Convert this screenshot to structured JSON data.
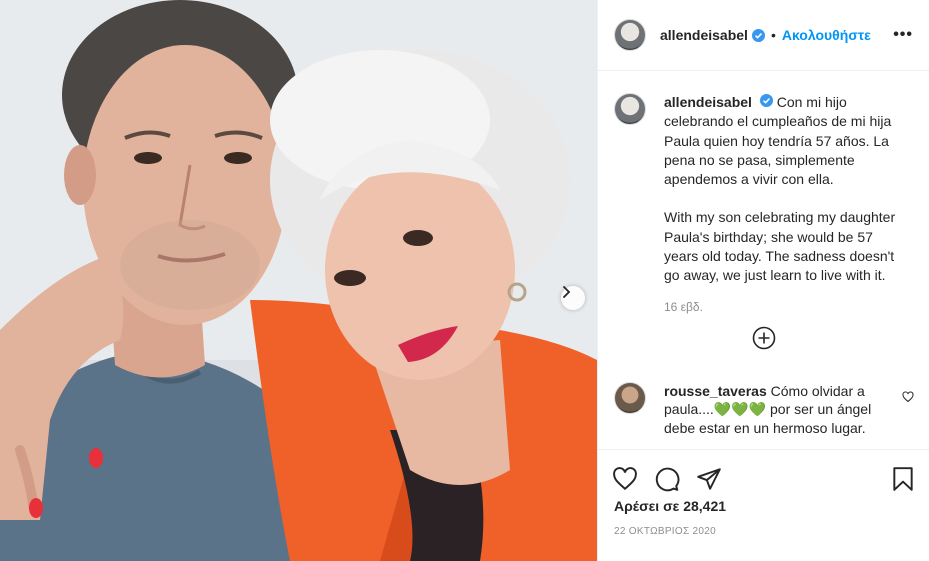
{
  "post": {
    "username": "allendeisabel",
    "follow_label": "Ακολουθήστε",
    "separator": "•",
    "more_label": "•••"
  },
  "caption": {
    "username": "allendeisabel",
    "text_es": "Con mi hijo celebrando el cumpleaños de mi hija Paula quien hoy tendría 57 años. La pena no se pasa, simplemente apendemos a vivir con ella.",
    "text_en": "With my son celebrating my daughter Paula's birthday; she would be 57 years old today. The sadness doesn't go away, we just learn to live with it.",
    "time": "16 εβδ."
  },
  "comment": {
    "username": "rousse_taveras",
    "text_before": "Cómo olvidar a paula....",
    "emoji": "💚💚💚",
    "text_after": " por ser un ángel debe estar en un hermoso lugar."
  },
  "likes": "Αρέσει σε 28,421",
  "date": "22 ΟΚΤΩΒΡΙΟΣ 2020",
  "colors": {
    "accent": "#0095f6",
    "verified": "#3897f0",
    "muted": "#8e8e8e",
    "shirt_orange": "#f0612a"
  },
  "icons": [
    "verified-icon",
    "more-icon",
    "load-more-icon",
    "heart-icon",
    "comment-icon",
    "share-icon",
    "save-icon",
    "chevron-right-icon"
  ]
}
